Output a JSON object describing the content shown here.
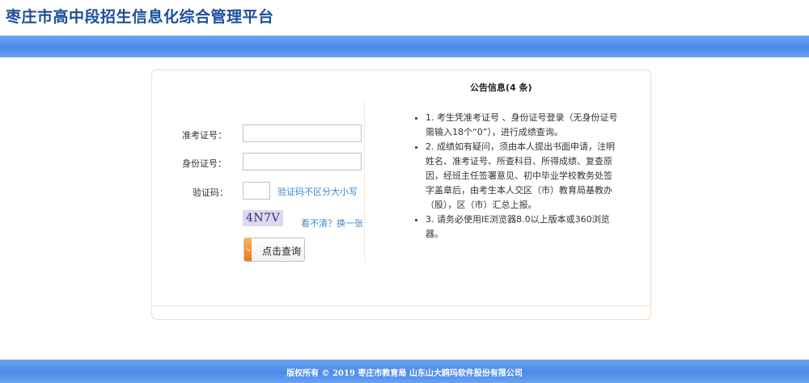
{
  "header": {
    "title": "枣庄市高中段招生信息化综合管理平台"
  },
  "login_form": {
    "exam_no_label": "准考证号：",
    "exam_no_value": "",
    "id_no_label": "身份证号：",
    "id_no_value": "",
    "captcha_label": "验证码：",
    "captcha_value": "",
    "captcha_hint": "验证码不区分大小写",
    "captcha_image_text": "4N7V",
    "refresh_link": "看不清？换一张",
    "submit_label": "点击查询"
  },
  "notice": {
    "title": "公告信息(4 条)",
    "items": [
      "1. 考生凭准考证号 、身份证号登录（无身份证号需输入18个“0”），进行成绩查询。",
      "2. 成绩如有疑问，须由本人提出书面申请，注明姓名、准考证号、所查科目、所得成绩、复查原因，经班主任签署意见、初中毕业学校教务处签字盖章后，由考生本人交区（市）教育局基教办（股），区（市）汇总上报。",
      "3. 请务必使用IE浏览器8.0以上版本或360浏览器。"
    ]
  },
  "footer": {
    "copyright": "版权所有 © 2019 枣庄市教育局 山东山大鸥玛软件股份有限公司"
  },
  "colors": {
    "title": "#1c4f9c",
    "band": "#5a96ee",
    "panel_border": "#f3dccb",
    "link": "#3f8ac9",
    "button_icon": "#e97a1b"
  }
}
